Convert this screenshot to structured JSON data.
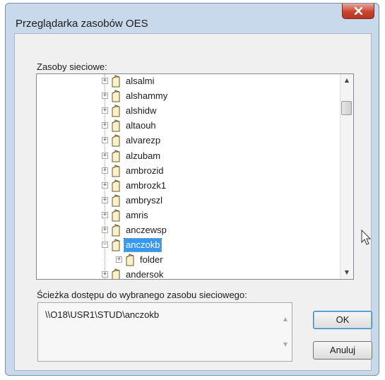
{
  "window": {
    "title": "Przeglądarka zasobów OES",
    "close_glyph": "✕"
  },
  "tree": {
    "label": "Zasoby sieciowe:",
    "items": [
      {
        "label": "alsalmi",
        "level": 0,
        "expanded": false,
        "selected": false
      },
      {
        "label": "alshammy",
        "level": 0,
        "expanded": false,
        "selected": false
      },
      {
        "label": "alshidw",
        "level": 0,
        "expanded": false,
        "selected": false
      },
      {
        "label": "altaouh",
        "level": 0,
        "expanded": false,
        "selected": false
      },
      {
        "label": "alvarezp",
        "level": 0,
        "expanded": false,
        "selected": false
      },
      {
        "label": "alzubam",
        "level": 0,
        "expanded": false,
        "selected": false
      },
      {
        "label": "ambrozid",
        "level": 0,
        "expanded": false,
        "selected": false
      },
      {
        "label": "ambrozk1",
        "level": 0,
        "expanded": false,
        "selected": false
      },
      {
        "label": "ambryszl",
        "level": 0,
        "expanded": false,
        "selected": false
      },
      {
        "label": "amris",
        "level": 0,
        "expanded": false,
        "selected": false
      },
      {
        "label": "anczewsp",
        "level": 0,
        "expanded": false,
        "selected": false
      },
      {
        "label": "anczokb",
        "level": 0,
        "expanded": true,
        "selected": true
      },
      {
        "label": "folder",
        "level": 1,
        "expanded": false,
        "selected": false
      },
      {
        "label": "andersok",
        "level": 0,
        "expanded": false,
        "selected": false
      }
    ],
    "expander_collapsed": "+",
    "expander_expanded": "−",
    "scroll_up": "▲",
    "scroll_down": "▼"
  },
  "path": {
    "label": "Ścieżka dostępu do wybranego zasobu sieciowego:",
    "value": "\\\\O18\\USR1\\STUD\\anczokb",
    "scroll_up": "▲",
    "scroll_down": "▼"
  },
  "buttons": {
    "ok": "OK",
    "cancel": "Anuluj"
  },
  "icons": [
    "folder-icon",
    "expand-icon",
    "close-icon",
    "mouse-cursor-icon"
  ]
}
